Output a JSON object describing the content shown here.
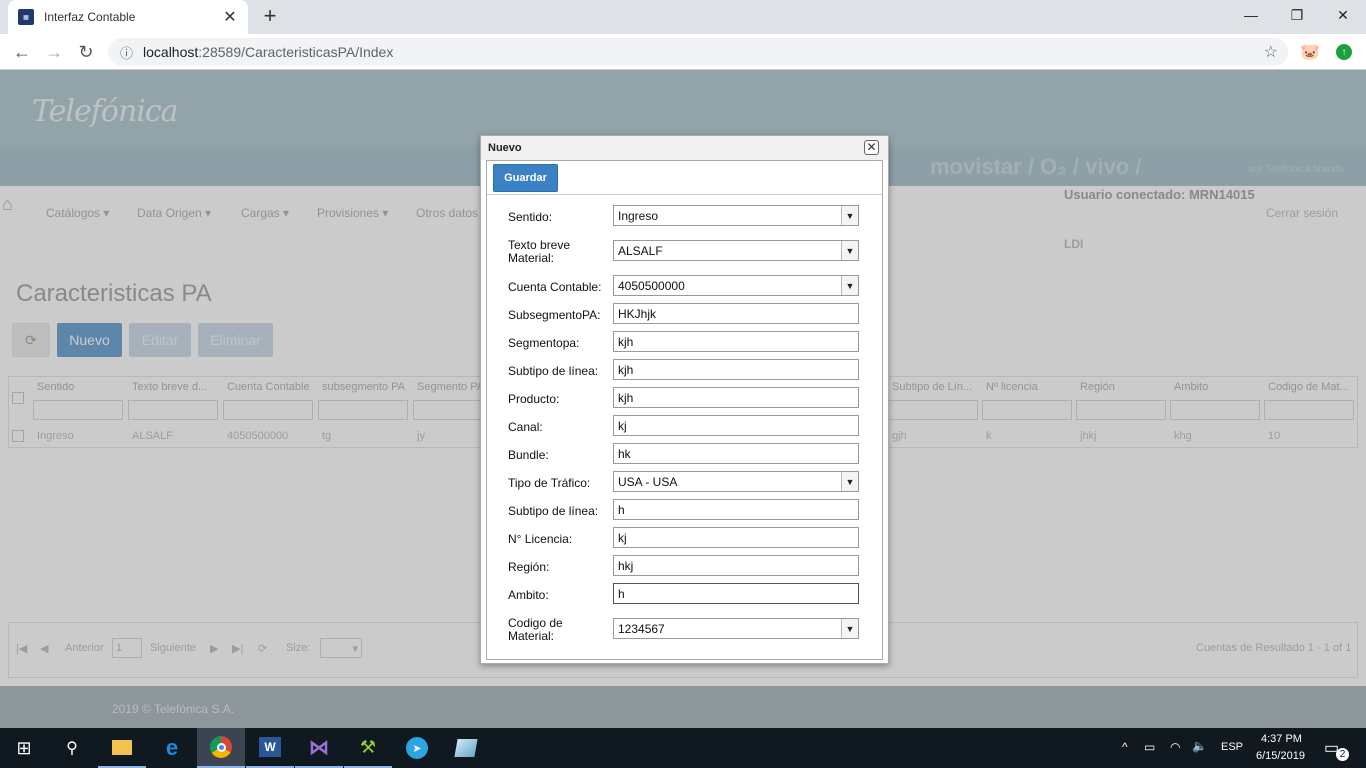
{
  "browser": {
    "tab_title": "Interfaz Contable",
    "url_host": "localhost",
    "url_path": ":28589/CaracteristicasPA/Index"
  },
  "header": {
    "logo": "Telefónica",
    "brands": "movistar  /  O₂  /  vivo  /",
    "brands_note": "are Telefónica brands"
  },
  "nav": {
    "items": [
      "Catálogos ▾",
      "Data Origen ▾",
      "Cargas ▾",
      "Provisiones ▾",
      "Otros datos"
    ],
    "user": "Usuario conectado: MRN14015",
    "logout": "Cerrar sesión",
    "area": "LDI"
  },
  "page": {
    "title": "Caracteristicas PA",
    "buttons": {
      "new": "Nuevo",
      "edit": "Editar",
      "delete": "Eliminar"
    }
  },
  "grid": {
    "headers": [
      "Sentido",
      "Texto breve d...",
      "Cuenta Contable",
      "subsegmento PA",
      "Segmento PA",
      "Subtipo de Lín...",
      "Nº licencia",
      "Región",
      "Ambito",
      "Codigo de Mat..."
    ],
    "row": [
      "Ingreso",
      "ALSALF",
      "4050500000",
      "tg",
      "jy",
      "gjh",
      "k",
      "jhkj",
      "khg",
      "10"
    ]
  },
  "pager": {
    "prev": "Anterior",
    "page": "1",
    "next": "Siguiente",
    "size_label": "Size:",
    "summary": "Cuentas de Resultado 1 - 1 of 1"
  },
  "footer": {
    "copyright": "2019 © Telefónica S.A."
  },
  "dialog": {
    "title": "Nuevo",
    "save_label": "Guardar",
    "fields": [
      {
        "label": "Sentido:",
        "value": "Ingreso",
        "type": "select"
      },
      {
        "label": "Texto breve Material:",
        "value": "ALSALF",
        "type": "select"
      },
      {
        "label": "Cuenta Contable:",
        "value": "4050500000",
        "type": "select"
      },
      {
        "label": "SubsegmentoPA:",
        "value": "HKJhjk",
        "type": "text"
      },
      {
        "label": "Segmentopa:",
        "value": "kjh",
        "type": "text"
      },
      {
        "label": "Subtipo de línea:",
        "value": "kjh",
        "type": "text"
      },
      {
        "label": "Producto:",
        "value": "kjh",
        "type": "text"
      },
      {
        "label": "Canal:",
        "value": "kj",
        "type": "text"
      },
      {
        "label": "Bundle:",
        "value": "hk",
        "type": "text"
      },
      {
        "label": "Tipo de Tráfico:",
        "value": "USA - USA",
        "type": "select"
      },
      {
        "label": "Subtipo de línea:",
        "value": "h",
        "type": "text"
      },
      {
        "label": "N° Licencia:",
        "value": "kj",
        "type": "text"
      },
      {
        "label": "Región:",
        "value": "hkj",
        "type": "text"
      },
      {
        "label": "Ambito:",
        "value": "h",
        "type": "text"
      },
      {
        "label": "Codigo de Material:",
        "value": "1234567",
        "type": "select"
      }
    ]
  },
  "taskbar": {
    "lang": "ESP",
    "time": "4:37 PM",
    "date": "6/15/2019",
    "notifications": "2"
  }
}
